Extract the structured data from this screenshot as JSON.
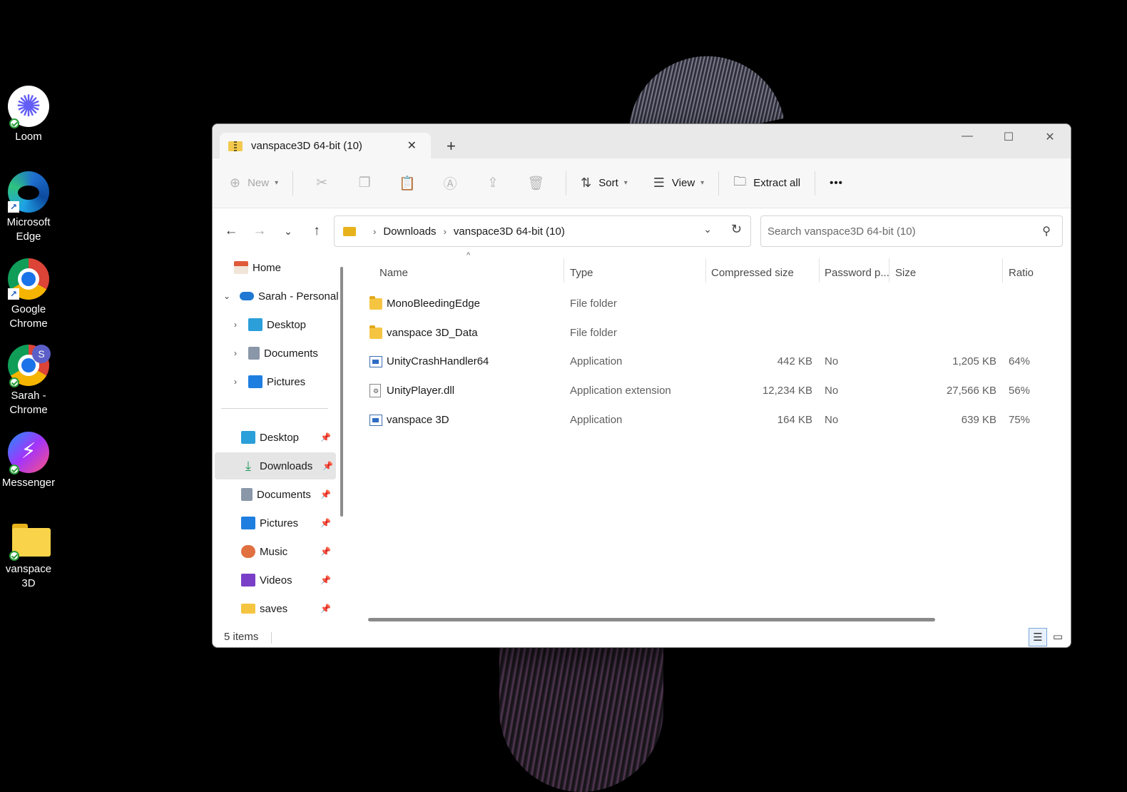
{
  "desktop": {
    "icons": [
      {
        "label": "Loom"
      },
      {
        "label": "Microsoft Edge"
      },
      {
        "label": "Google Chrome"
      },
      {
        "label": "Sarah - Chrome",
        "avatar": "S"
      },
      {
        "label": "Messenger"
      },
      {
        "label": "vanspace 3D"
      }
    ]
  },
  "window": {
    "tab_title": "vanspace3D 64-bit (10)",
    "new_tab": "+",
    "controls": {
      "minimize": "—",
      "maximize": "☐",
      "close": "✕"
    }
  },
  "toolbar": {
    "new": "New",
    "sort": "Sort",
    "view": "View",
    "extract_all": "Extract all",
    "more": "•••"
  },
  "address": {
    "crumbs": [
      "Downloads",
      "vanspace3D 64-bit (10)"
    ],
    "search_placeholder": "Search vanspace3D 64-bit (10)"
  },
  "sidebar": {
    "home": "Home",
    "onedrive": "Sarah - Personal",
    "onedrive_children": [
      "Desktop",
      "Documents",
      "Pictures"
    ],
    "quick_access": [
      "Desktop",
      "Downloads",
      "Documents",
      "Pictures",
      "Music",
      "Videos",
      "saves"
    ]
  },
  "columns": {
    "name": "Name",
    "type": "Type",
    "compressed": "Compressed size",
    "password": "Password p...",
    "size": "Size",
    "ratio": "Ratio"
  },
  "files": [
    {
      "name": "MonoBleedingEdge",
      "type": "File folder",
      "compressed": "",
      "password": "",
      "size": "",
      "ratio": "",
      "kind": "folder"
    },
    {
      "name": "vanspace 3D_Data",
      "type": "File folder",
      "compressed": "",
      "password": "",
      "size": "",
      "ratio": "",
      "kind": "folder"
    },
    {
      "name": "UnityCrashHandler64",
      "type": "Application",
      "compressed": "442 KB",
      "password": "No",
      "size": "1,205 KB",
      "ratio": "64%",
      "kind": "app"
    },
    {
      "name": "UnityPlayer.dll",
      "type": "Application extension",
      "compressed": "12,234 KB",
      "password": "No",
      "size": "27,566 KB",
      "ratio": "56%",
      "kind": "dll"
    },
    {
      "name": "vanspace 3D",
      "type": "Application",
      "compressed": "164 KB",
      "password": "No",
      "size": "639 KB",
      "ratio": "75%",
      "kind": "app"
    }
  ],
  "status": {
    "items": "5 items"
  }
}
